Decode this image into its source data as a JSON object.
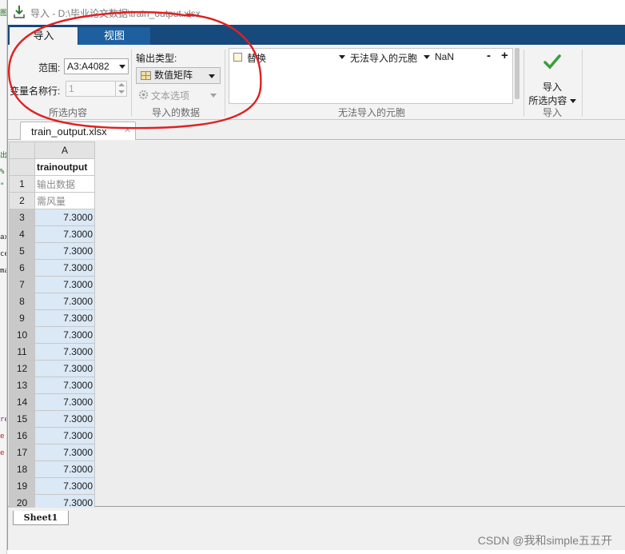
{
  "background_editor": {
    "glyphs": [
      "图",
      "出",
      "%",
      "\"",
      "ax",
      "ce",
      "ma",
      "re",
      "e",
      "e"
    ]
  },
  "titlebar": {
    "title": "导入 - D:\\毕业论文数据\\train_output.xlsx"
  },
  "tabs": [
    {
      "label": "导入",
      "active": true
    },
    {
      "label": "视图",
      "active": false
    }
  ],
  "selection": {
    "range_label": "范围:",
    "range_value": "A3:A4082",
    "varname_row_label": "变量名称行:",
    "varname_row_value": "1",
    "group_label": "所选内容"
  },
  "imported_data": {
    "output_type_label": "输出类型:",
    "output_type_value": "数值矩阵",
    "text_options_label": "文本选项",
    "group_label": "导入的数据"
  },
  "unimportable": {
    "rule_action": "替换",
    "rule_condition": "无法导入的元胞",
    "rule_value": "NaN",
    "remove_label": "-",
    "add_label": "+",
    "group_label": "无法导入的元胞"
  },
  "import_group": {
    "button_line1": "导入",
    "button_line2": "所选内容",
    "group_label": "导入"
  },
  "document_tab": {
    "name": "train_output.xlsx",
    "close_glyph": "✕"
  },
  "sheet": {
    "column_letter": "A",
    "variable_name": "trainoutput",
    "text_rows": [
      {
        "row": "1",
        "value": "输出数据"
      },
      {
        "row": "2",
        "value": "需风量"
      }
    ],
    "numeric_rows": [
      {
        "row": "3",
        "value": "7.3000"
      },
      {
        "row": "4",
        "value": "7.3000"
      },
      {
        "row": "5",
        "value": "7.3000"
      },
      {
        "row": "6",
        "value": "7.3000"
      },
      {
        "row": "7",
        "value": "7.3000"
      },
      {
        "row": "8",
        "value": "7.3000"
      },
      {
        "row": "9",
        "value": "7.3000"
      },
      {
        "row": "10",
        "value": "7.3000"
      },
      {
        "row": "11",
        "value": "7.3000"
      },
      {
        "row": "12",
        "value": "7.3000"
      },
      {
        "row": "13",
        "value": "7.3000"
      },
      {
        "row": "14",
        "value": "7.3000"
      },
      {
        "row": "15",
        "value": "7.3000"
      },
      {
        "row": "16",
        "value": "7.3000"
      },
      {
        "row": "17",
        "value": "7.3000"
      },
      {
        "row": "18",
        "value": "7.3000"
      },
      {
        "row": "19",
        "value": "7.3000"
      },
      {
        "row": "20",
        "value": "7.3000"
      }
    ],
    "tab_name": "Sheet1"
  },
  "watermark": "CSDN @我和simple五五开",
  "colors": {
    "tabstrip": "#16497c",
    "selection_fill": "#dbe8f5",
    "annotation": "#e02020",
    "check": "#3aa03a"
  }
}
